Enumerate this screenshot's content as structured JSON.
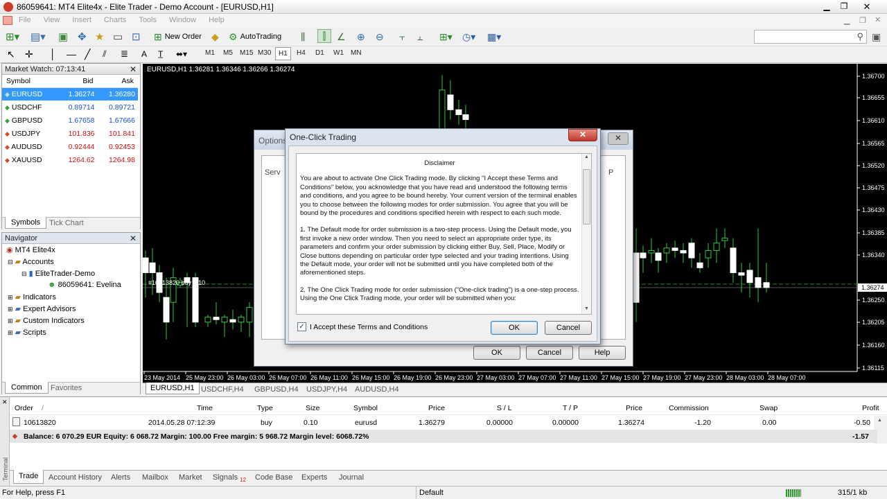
{
  "window": {
    "title": "86059641: MT4 Elite4x - Elite Trader - Demo Account - [EURUSD,H1]"
  },
  "menu": [
    "File",
    "View",
    "Insert",
    "Charts",
    "Tools",
    "Window",
    "Help"
  ],
  "toolbar": {
    "new_order": "New Order",
    "autotrading": "AutoTrading"
  },
  "timeframes": [
    "M1",
    "M5",
    "M15",
    "M30",
    "H1",
    "H4",
    "D1",
    "W1",
    "MN"
  ],
  "market_watch": {
    "title": "Market Watch: 07:13:41",
    "headers": [
      "Symbol",
      "Bid",
      "Ask"
    ],
    "rows": [
      {
        "symbol": "EURUSD",
        "bid": "1.36274",
        "ask": "1.36280",
        "dir": "up"
      },
      {
        "symbol": "USDCHF",
        "bid": "0.89714",
        "ask": "0.89721",
        "dir": "up"
      },
      {
        "symbol": "GBPUSD",
        "bid": "1.67658",
        "ask": "1.67666",
        "dir": "up"
      },
      {
        "symbol": "USDJPY",
        "bid": "101.836",
        "ask": "101.841",
        "dir": "down"
      },
      {
        "symbol": "AUDUSD",
        "bid": "0.92444",
        "ask": "0.92453",
        "dir": "down"
      },
      {
        "symbol": "XAUUSD",
        "bid": "1264.62",
        "ask": "1264.98",
        "dir": "down"
      }
    ],
    "tabs": [
      "Symbols",
      "Tick Chart"
    ]
  },
  "navigator": {
    "title": "Navigator",
    "items": [
      "MT4 Elite4x",
      "Accounts",
      "EliteTrader-Demo",
      "86059641: Evelina",
      "Indicators",
      "Expert Advisors",
      "Custom Indicators",
      "Scripts"
    ],
    "tabs": [
      "Common",
      "Favorites"
    ]
  },
  "chart": {
    "header": "EURUSD,H1  1.36281 1.36346 1.36266 1.36274",
    "order_label": "#10613820 buy 0.10",
    "price_labels": [
      "1.36700",
      "1.36655",
      "1.36610",
      "1.36565",
      "1.36520",
      "1.36475",
      "1.36430",
      "1.36385",
      "1.36340",
      "1.36274",
      "1.36250",
      "1.36205",
      "1.36160",
      "1.36115"
    ],
    "current_price": "1.36274",
    "time_labels": [
      "23 May 2014",
      "25 May 23:00",
      "26 May 03:00",
      "26 May 07:00",
      "26 May 11:00",
      "26 May 15:00",
      "26 May 19:00",
      "26 May 23:00",
      "27 May 03:00",
      "27 May 07:00",
      "27 May 11:00",
      "27 May 15:00",
      "27 May 19:00",
      "27 May 23:00",
      "28 May 03:00",
      "28 May 07:00"
    ],
    "tabs": [
      "EURUSD,H1",
      "USDCHF,H4",
      "GBPUSD,H4",
      "USDJPY,H4",
      "AUDUSD,H4"
    ]
  },
  "options_dialog": {
    "title": "Options",
    "tab_left": "Serv",
    "tab_right": "P",
    "ok": "OK",
    "cancel": "Cancel",
    "help": "Help"
  },
  "oct_dialog": {
    "title": "One-Click Trading",
    "heading": "Disclaimer",
    "p1": "You are about to activate One Click Trading mode. By clicking \"I Accept these Terms and Conditions\" below, you acknowledge that you have read and understood the following terms and conditions, and you agree to be bound hereby. Your current version of the terminal enables you to choose between the following modes for order submission. You agree that you will be bound by the procedures and conditions specified herein with respect to each such mode.",
    "p2": "1. The Default mode for order submission is a two-step process. Using the Default mode, you first invoke a new order window. Then you need to select an appropriate order type, its parameters and confirm your order submission by clicking either Buy, Sell, Place, Modify or Close buttons depending on particular order type selected and your trading intentions. Using the Default mode, your order will not be submitted until you have completed both of the aforementioned steps.",
    "p3": "2. The One Click Trading mode for order submission (\"One-click trading\") is a one-step process. Using the One Click Trading mode, your order will be submitted when you:",
    "checkbox": "I Accept these Terms and Conditions",
    "ok": "OK",
    "cancel": "Cancel"
  },
  "terminal": {
    "headers": [
      "Order",
      "/",
      "Time",
      "Type",
      "Size",
      "Symbol",
      "Price",
      "S / L",
      "T / P",
      "Price",
      "Commission",
      "Swap",
      "Profit"
    ],
    "row": {
      "order": "10613820",
      "time": "2014.05.28 07:12:39",
      "type": "buy",
      "size": "0.10",
      "symbol": "eurusd",
      "price": "1.36279",
      "sl": "0.00000",
      "tp": "0.00000",
      "price2": "1.36274",
      "commission": "-1.20",
      "swap": "0.00",
      "profit": "-0.50"
    },
    "balance": "Balance: 6 070.29 EUR  Equity: 6 068.72  Margin: 100.00  Free margin: 5 968.72  Margin level: 6068.72%",
    "balance_profit": "-1.57",
    "tabs": [
      "Trade",
      "Account History",
      "Alerts",
      "Mailbox",
      "Market",
      "Signals",
      "Code Base",
      "Experts",
      "Journal"
    ],
    "signals_badge": "12",
    "side_label": "Terminal"
  },
  "status": {
    "help": "For Help, press F1",
    "profile": "Default",
    "traffic": "315/1 kb"
  }
}
